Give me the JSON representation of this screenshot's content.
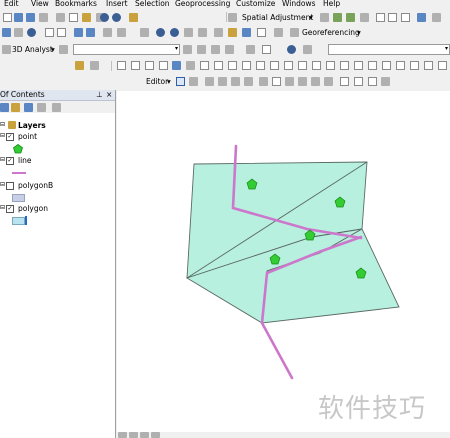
{
  "menu": [
    "Edit",
    "View",
    "Bookmarks",
    "Insert",
    "Selection",
    "Geoprocessing",
    "Customize",
    "Windows",
    "Help"
  ],
  "toolbar": {
    "spatial_adjustment": "Spatial Adjustment",
    "georeferencing": "Georeferencing",
    "analyst_3d": "3D Analyst",
    "editor": "Editor"
  },
  "toc": {
    "title": "Of Contents",
    "root": "Layers",
    "layers": [
      {
        "name": "point",
        "checked": true
      },
      {
        "name": "line",
        "checked": true
      },
      {
        "name": "polygonB",
        "checked": false
      },
      {
        "name": "polygon",
        "checked": true
      }
    ]
  },
  "colors": {
    "polygon_fill": "#b8f0df",
    "polygon_edge": "#5a6a64",
    "line": "#cc77cc",
    "point": "#33cc33"
  },
  "watermark": "软件技巧"
}
